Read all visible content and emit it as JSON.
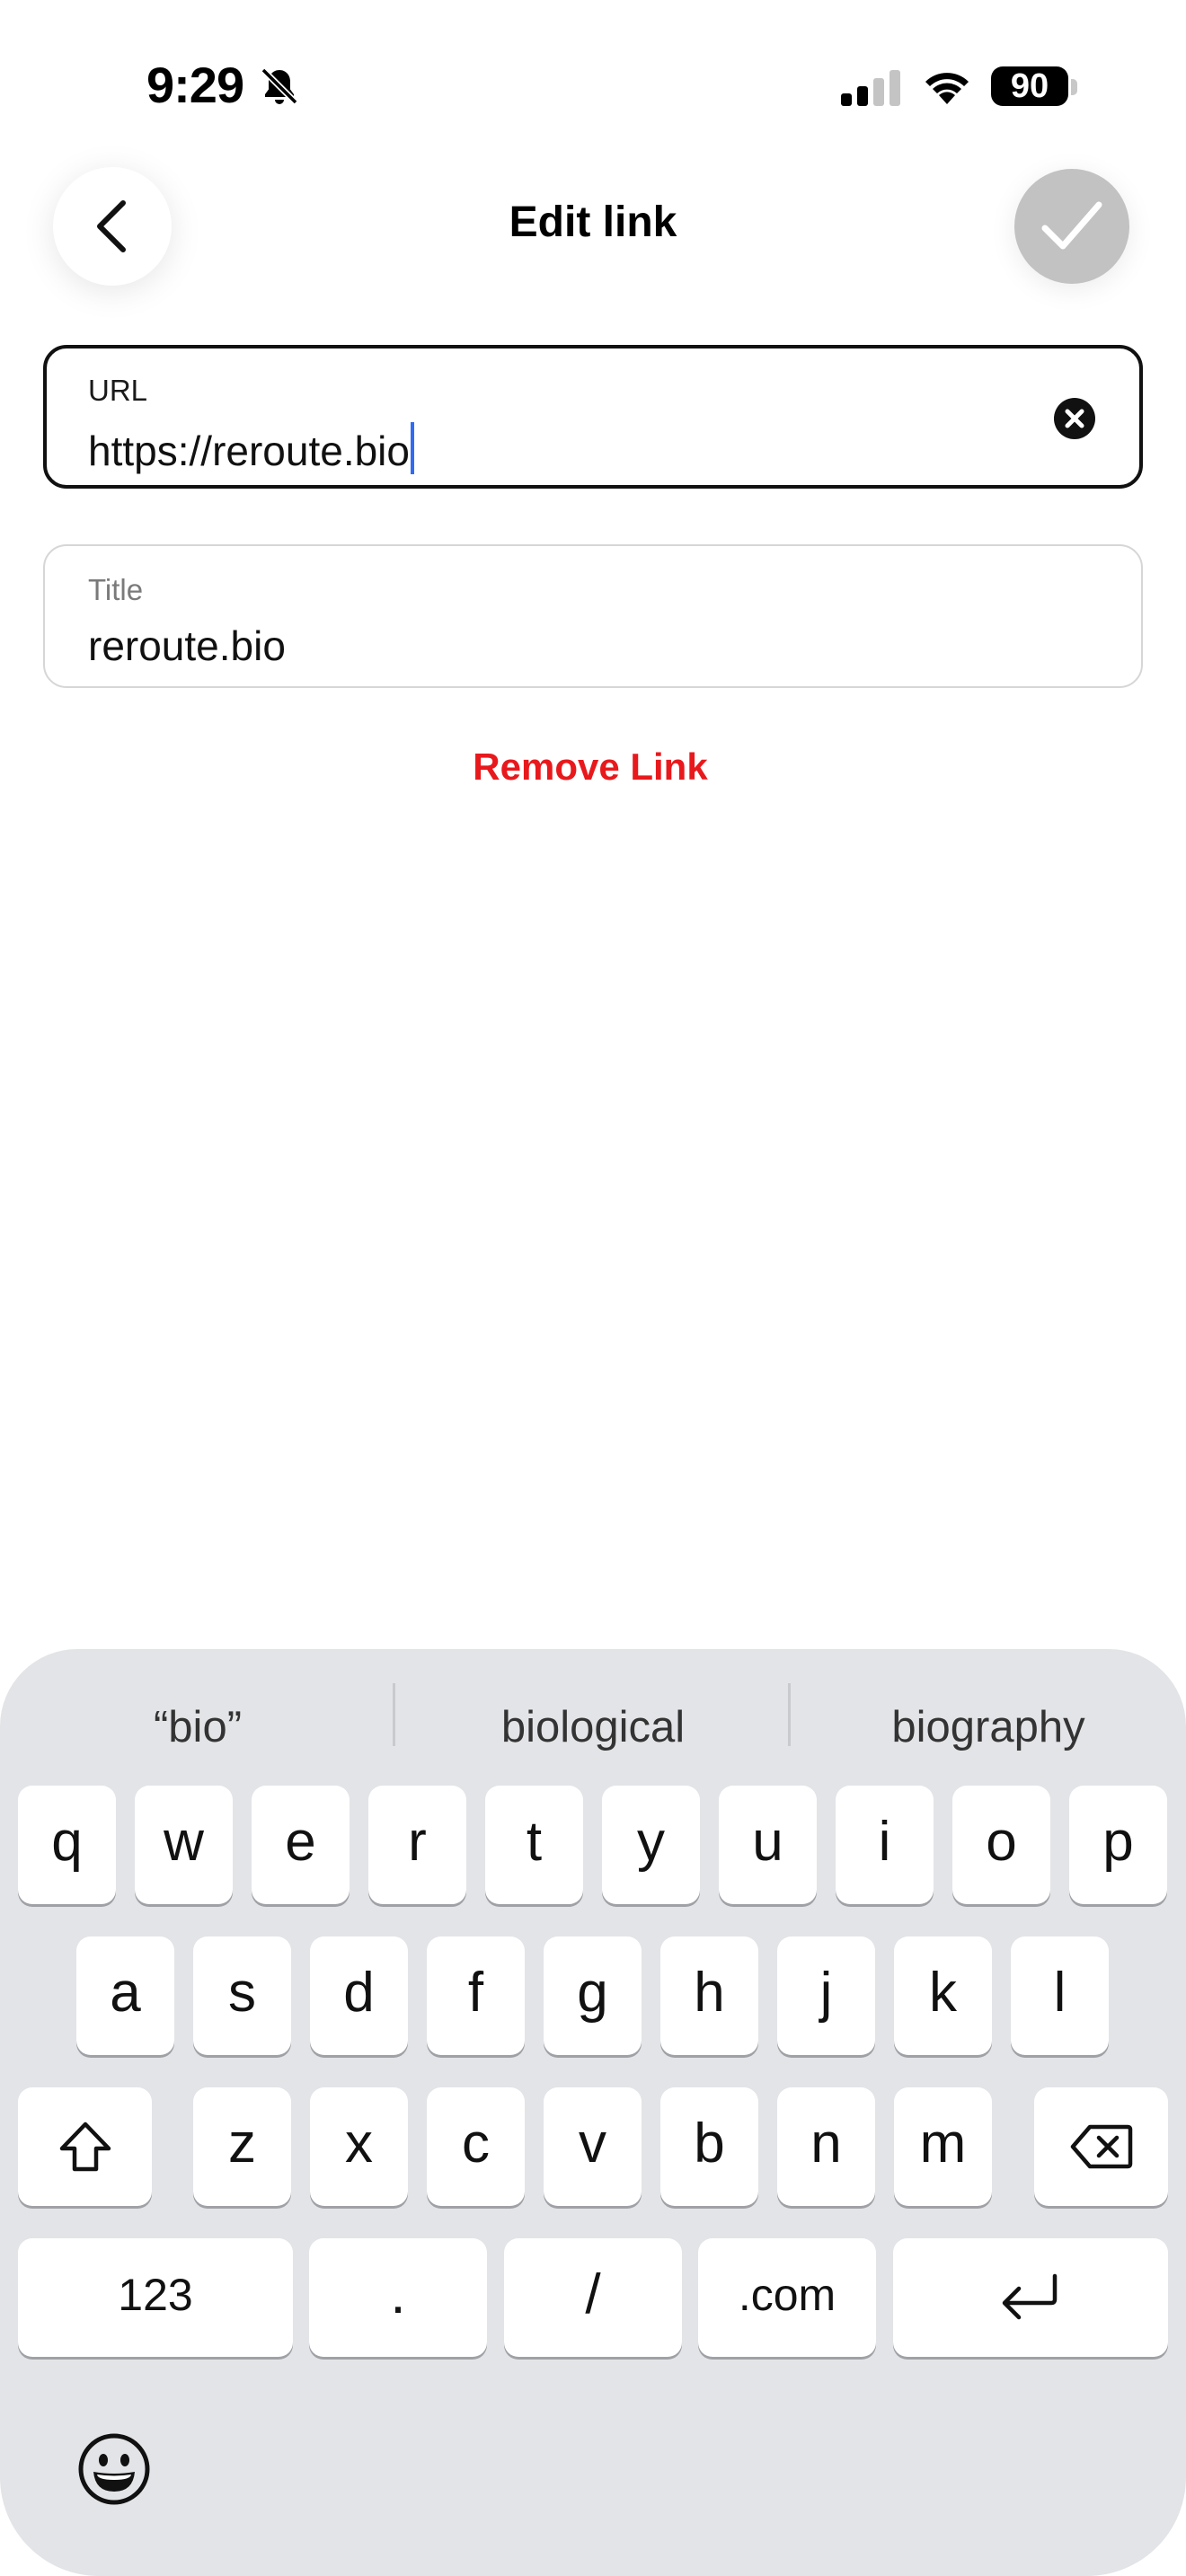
{
  "status_bar": {
    "time": "9:29",
    "battery_level": "90",
    "icons": [
      "bell-muted-icon",
      "cellular-signal-icon",
      "wifi-icon",
      "battery-icon"
    ]
  },
  "header": {
    "title": "Edit link",
    "back_icon": "chevron-left-icon",
    "confirm_icon": "checkmark-icon"
  },
  "form": {
    "url": {
      "label": "URL",
      "value": "https://reroute.bio",
      "clear_icon": "clear-circle-icon"
    },
    "title": {
      "label": "Title",
      "value": "reroute.bio"
    },
    "remove_label": "Remove Link"
  },
  "colors": {
    "accent_red": "#e8191c",
    "caret_blue": "#2f6cf3",
    "confirm_disabled": "#c2c2c2",
    "keyboard_bg": "#e3e4e7"
  },
  "keyboard": {
    "suggestions": [
      "“bio”",
      "biological",
      "biography"
    ],
    "rows": [
      [
        "q",
        "w",
        "e",
        "r",
        "t",
        "y",
        "u",
        "i",
        "o",
        "p"
      ],
      [
        "a",
        "s",
        "d",
        "f",
        "g",
        "h",
        "j",
        "k",
        "l"
      ],
      [
        "z",
        "x",
        "c",
        "v",
        "b",
        "n",
        "m"
      ]
    ],
    "bottom_row": {
      "numbers": "123",
      "dot": ".",
      "slash": "/",
      "dotcom": ".com"
    },
    "special_icons": [
      "shift-icon",
      "delete-icon",
      "return-icon",
      "emoji-icon"
    ]
  }
}
